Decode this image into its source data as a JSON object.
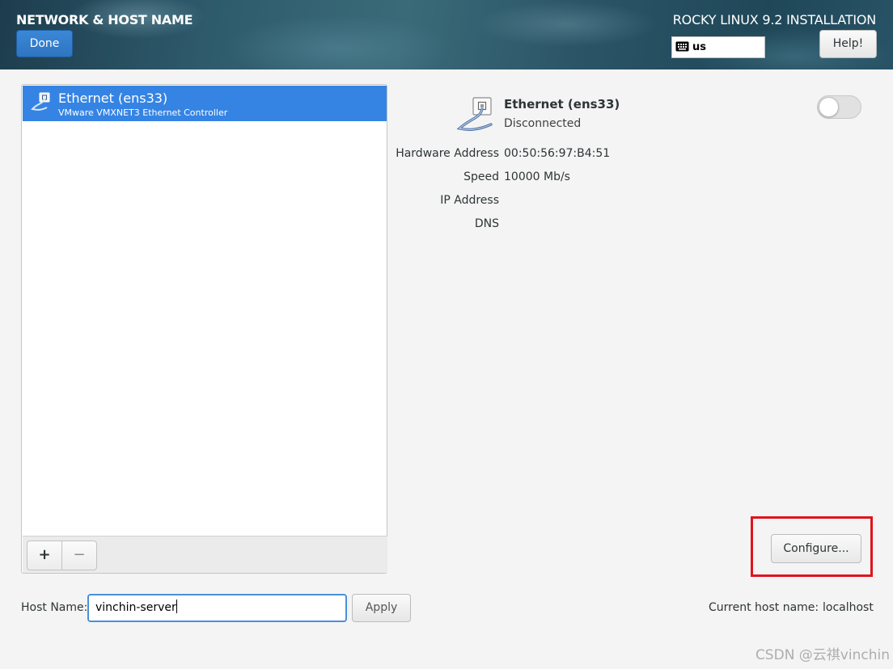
{
  "header": {
    "title": "NETWORK & HOST NAME",
    "done_label": "Done",
    "product": "ROCKY LINUX 9.2 INSTALLATION",
    "keyboard_layout": "us",
    "help_label": "Help!"
  },
  "device_list": {
    "items": [
      {
        "name": "Ethernet (ens33)",
        "description": "VMware VMXNET3 Ethernet Controller",
        "selected": true
      }
    ],
    "add_label": "+",
    "remove_label": "−"
  },
  "details": {
    "name": "Ethernet (ens33)",
    "status": "Disconnected",
    "enabled": false,
    "fields": [
      {
        "label": "Hardware Address",
        "value": "00:50:56:97:B4:51"
      },
      {
        "label": "Speed",
        "value": "10000 Mb/s"
      },
      {
        "label": "IP Address",
        "value": ""
      },
      {
        "label": "DNS",
        "value": ""
      }
    ],
    "configure_label": "Configure..."
  },
  "hostname": {
    "label": "Host Name:",
    "value": "vinchin-server",
    "apply_label": "Apply",
    "current_label": "Current host name:",
    "current_value": "localhost"
  },
  "watermark": "CSDN @云祺vinchin",
  "colors": {
    "accent": "#3584e4",
    "highlight_box": "#e0141c"
  }
}
